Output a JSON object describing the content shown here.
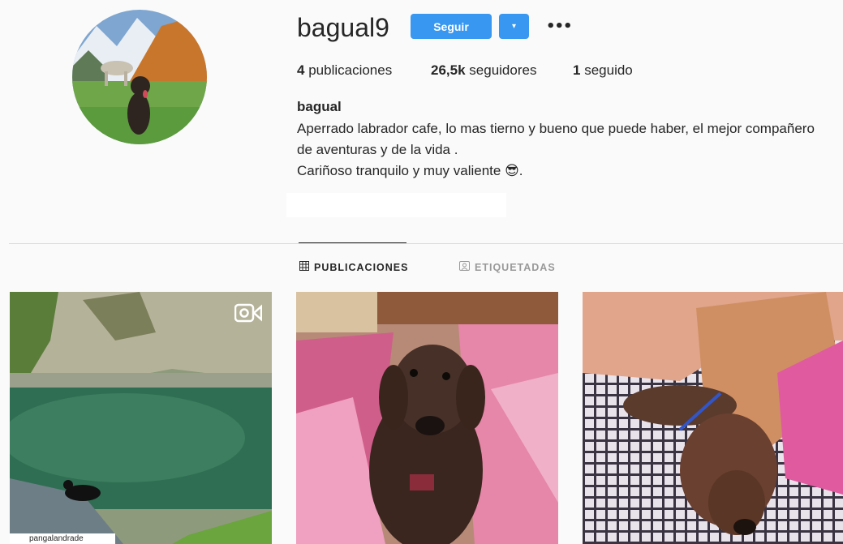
{
  "profile": {
    "username": "bagual9",
    "follow_label": "Seguir",
    "dropdown_glyph": "▾",
    "more_glyph": "•••",
    "stats": [
      {
        "count": "4",
        "label": "publicaciones"
      },
      {
        "count": "26,5k",
        "label": "seguidores"
      },
      {
        "count": "1",
        "label": "seguido"
      }
    ],
    "full_name": "bagual",
    "bio_lines": [
      "Aperrado labrador cafe, lo mas tierno y bueno que puede haber, el mejor compañero",
      "de aventuras y de la vida .",
      "Cariñoso tranquilo y muy valiente 😎."
    ]
  },
  "tabs": [
    {
      "label": "PUBLICACIONES",
      "icon": "grid-icon",
      "active": true
    },
    {
      "label": "ETIQUETADAS",
      "icon": "tagged-person-icon",
      "active": false
    }
  ],
  "posts": [
    {
      "description": "video",
      "icon": "video-icon",
      "overlay_text": "pangalandrade"
    },
    {
      "description": "photo"
    },
    {
      "description": "photo"
    }
  ],
  "colors": {
    "accent": "#3897f0",
    "text": "#262626",
    "muted": "#999999",
    "divider": "#dbdbdb",
    "background": "#fafafa"
  }
}
